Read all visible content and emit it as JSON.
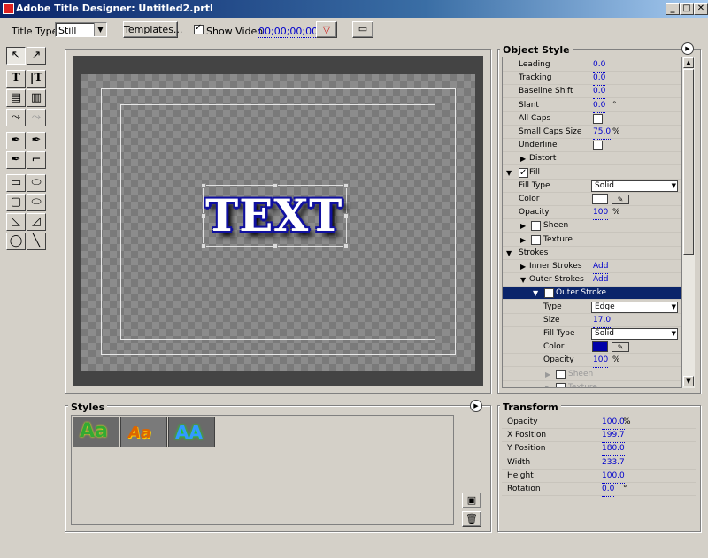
{
  "window": {
    "title": "Adobe Title Designer: Untitled2.prtl",
    "min_label": "_",
    "max_label": "□",
    "close_label": "✕"
  },
  "toolbar": {
    "title_type_label": "Title Type:",
    "title_type_value": "Still",
    "templates_label": "Templates...",
    "show_video_label": "Show Video",
    "show_video_checked": true,
    "timecode": "00;00;00;00"
  },
  "canvas": {
    "text": "TEXT"
  },
  "object_style": {
    "header": "Object Style",
    "rows": [
      {
        "label": "Leading",
        "value": "0.0"
      },
      {
        "label": "Tracking",
        "value": "0.0"
      },
      {
        "label": "Baseline Shift",
        "value": "0.0"
      },
      {
        "label": "Slant",
        "value": "0.0",
        "unit": "°"
      },
      {
        "label": "All Caps",
        "checkbox": false
      },
      {
        "label": "Small Caps Size",
        "value": "75.0",
        "unit": "%"
      },
      {
        "label": "Underline",
        "checkbox": false
      },
      {
        "label": "Distort"
      },
      {
        "label": "Fill",
        "checkbox": true
      },
      {
        "label": "Fill Type",
        "select": "Solid"
      },
      {
        "label": "Color",
        "color": "#ffffff"
      },
      {
        "label": "Opacity",
        "value": "100",
        "unit": "%"
      },
      {
        "label": "Sheen",
        "checkbox": false
      },
      {
        "label": "Texture",
        "checkbox": false
      },
      {
        "label": "Strokes"
      },
      {
        "label": "Inner Strokes",
        "link": "Add"
      },
      {
        "label": "Outer Strokes",
        "link": "Add"
      },
      {
        "label": "Outer Stroke",
        "checkbox": true
      },
      {
        "label": "Type",
        "select": "Edge"
      },
      {
        "label": "Size",
        "value": "17.0"
      },
      {
        "label": "Fill Type",
        "select": "Solid"
      },
      {
        "label": "Color",
        "color": "#0000a8"
      },
      {
        "label": "Opacity",
        "value": "100",
        "unit": "%"
      },
      {
        "label": "Sheen",
        "checkbox": false
      },
      {
        "label": "Texture",
        "checkbox": false
      }
    ]
  },
  "styles": {
    "header": "Styles",
    "thumbs": [
      "Aa",
      "Aa",
      "AA"
    ]
  },
  "transform": {
    "header": "Transform",
    "rows": [
      {
        "label": "Opacity",
        "value": "100.0",
        "unit": "%"
      },
      {
        "label": "X Position",
        "value": "199.7"
      },
      {
        "label": "Y Position",
        "value": "180.0"
      },
      {
        "label": "Width",
        "value": "233.7"
      },
      {
        "label": "Height",
        "value": "100.0"
      },
      {
        "label": "Rotation",
        "value": "0.0",
        "unit": "°"
      }
    ]
  }
}
